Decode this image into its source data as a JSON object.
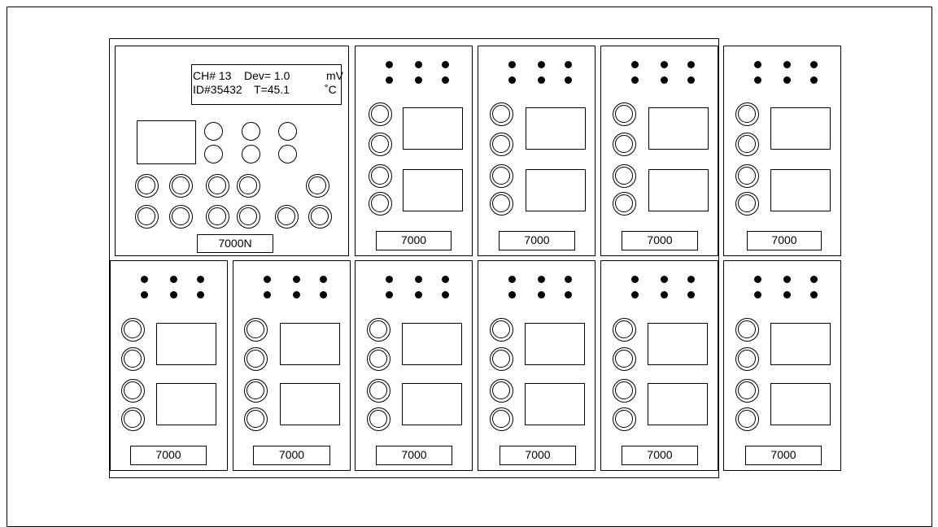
{
  "display": {
    "channel": "CH# 13",
    "deviation": "Dev= 1.0",
    "unit_top": "mV",
    "id": "ID#35432",
    "temperature": "T=45.1",
    "unit_bottom": "˚C"
  },
  "main_module": {
    "label": "7000N"
  },
  "top_modules": [
    {
      "label": "7000"
    },
    {
      "label": "7000"
    },
    {
      "label": "7000"
    },
    {
      "label": "7000"
    }
  ],
  "bottom_modules": [
    {
      "label": "7000"
    },
    {
      "label": "7000"
    },
    {
      "label": "7000"
    },
    {
      "label": "7000"
    },
    {
      "label": "7000"
    },
    {
      "label": "7000"
    }
  ]
}
